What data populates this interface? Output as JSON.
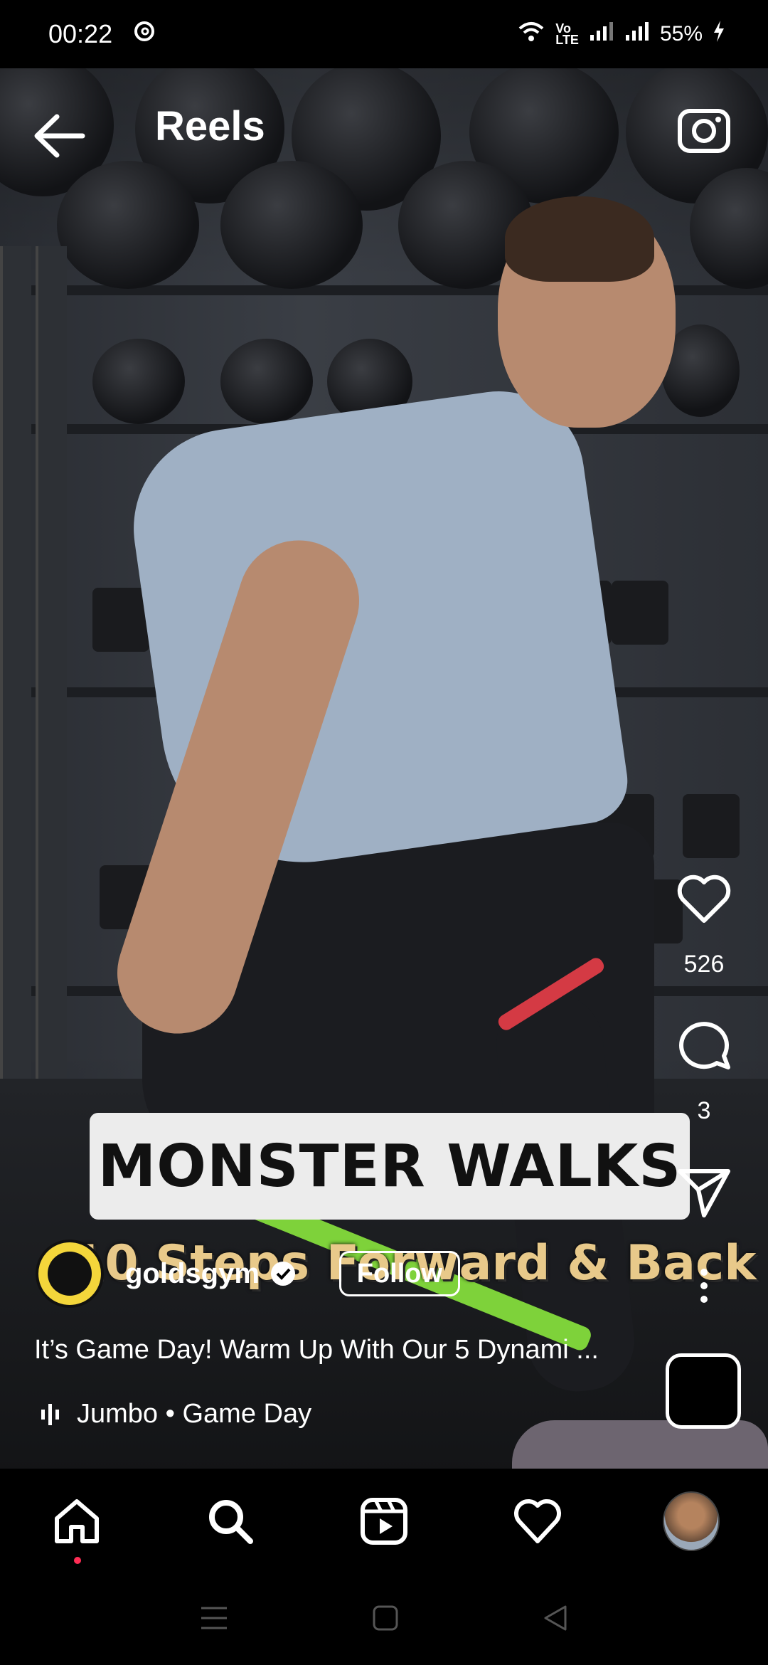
{
  "status_bar": {
    "time": "00:22",
    "battery": "55%"
  },
  "header": {
    "title": "Reels"
  },
  "video": {
    "caption_title": "MONSTER WALKS",
    "caption_subtitle": "10 Steps Forward & Back"
  },
  "actions": {
    "likes": "526",
    "comments": "3"
  },
  "post": {
    "username": "goldsgym",
    "follow_label": "Follow",
    "description": "It’s Game Day! Warm Up With Our 5 Dynami ...",
    "audio": "Jumbo • Game Day"
  },
  "bottom_nav": {
    "items": [
      "home",
      "search",
      "reels",
      "activity",
      "profile"
    ]
  },
  "colors": {
    "accent_dot": "#ff2d55",
    "background": "#000000",
    "logo_yellow": "#f4d63b"
  }
}
